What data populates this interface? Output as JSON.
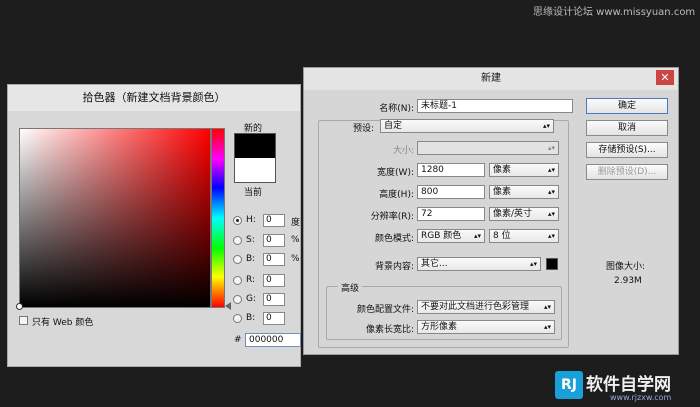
{
  "watermark_top": "思缘设计论坛 www.missyuan.com",
  "color_picker": {
    "title": "拾色器（新建文档背景颜色）",
    "new_label": "新的",
    "current_label": "当前",
    "new_color": "#000000",
    "current_color": "#ffffff",
    "web_only_label": "只有 Web 颜色",
    "fields": [
      {
        "label": "H:",
        "value": "0",
        "unit": "度",
        "selected": true
      },
      {
        "label": "S:",
        "value": "0",
        "unit": "%",
        "selected": false
      },
      {
        "label": "B:",
        "value": "0",
        "unit": "%",
        "selected": false
      },
      {
        "label": "R:",
        "value": "0",
        "unit": "",
        "selected": false
      },
      {
        "label": "G:",
        "value": "0",
        "unit": "",
        "selected": false
      },
      {
        "label": "B:",
        "value": "0",
        "unit": "",
        "selected": false
      }
    ],
    "hex_prefix": "#",
    "hex_value": "000000"
  },
  "new_dialog": {
    "title": "新建",
    "close": "✕",
    "name_label": "名称(N):",
    "name_value": "未标题-1",
    "preset_label": "预设:",
    "preset_value": "自定",
    "size_label": "大小:",
    "width_label": "宽度(W):",
    "width_value": "1280",
    "width_unit": "像素",
    "height_label": "高度(H):",
    "height_value": "800",
    "height_unit": "像素",
    "res_label": "分辨率(R):",
    "res_value": "72",
    "res_unit": "像素/英寸",
    "mode_label": "颜色模式:",
    "mode_value": "RGB 颜色",
    "depth_value": "8 位",
    "bg_label": "背景内容:",
    "bg_value": "其它...",
    "bg_color": "#000000",
    "advanced_label": "高级",
    "profile_label": "颜色配置文件:",
    "profile_value": "不要对此文档进行色彩管理",
    "aspect_label": "像素长宽比:",
    "aspect_value": "方形像素",
    "buttons": {
      "ok": "确定",
      "cancel": "取消",
      "save_preset": "存储预设(S)...",
      "delete_preset": "删除预设(D)..."
    },
    "image_size_label": "图像大小:",
    "image_size_value": "2.93M"
  },
  "watermark_logo": "软件自学网",
  "watermark_logo_mark": "RJ",
  "watermark_url": "www.rjzxw.com"
}
